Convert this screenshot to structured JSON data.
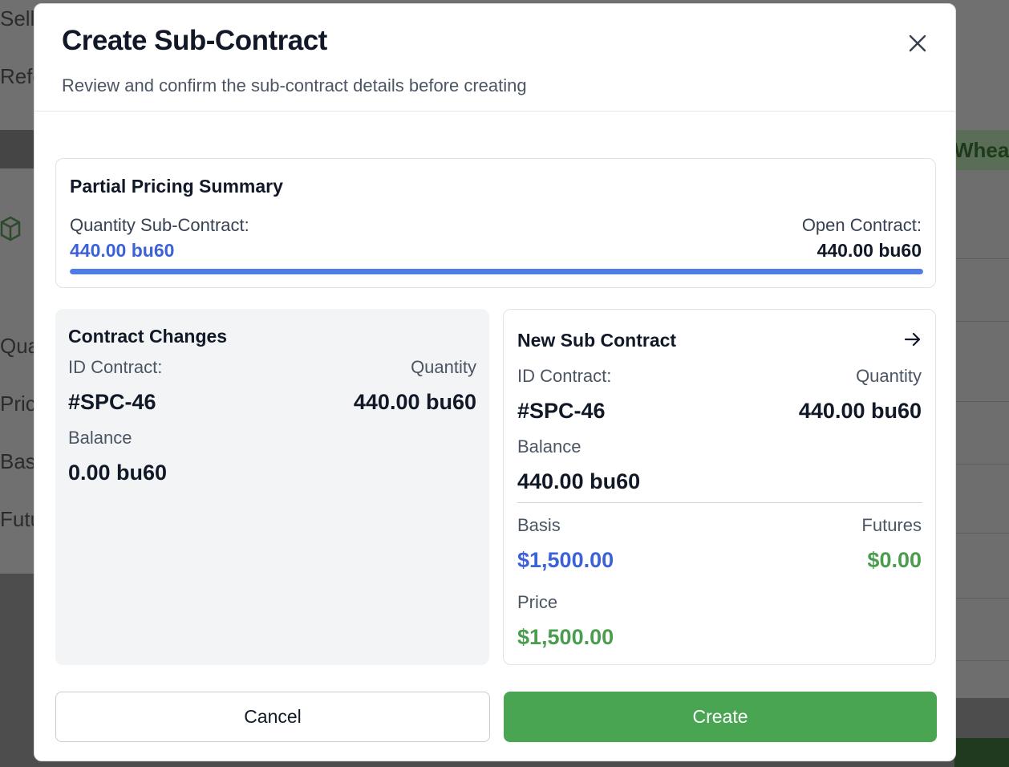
{
  "background": {
    "fragments": [
      "Selle",
      "Refe",
      "Qua",
      "Pric",
      "Basi",
      "Futu"
    ],
    "right_fragment": "Whea"
  },
  "modal": {
    "title": "Create Sub-Contract",
    "subtitle": "Review and confirm the sub-contract details before creating",
    "close_icon": "close-icon"
  },
  "summary": {
    "title": "Partial Pricing Summary",
    "left_label": "Quantity Sub-Contract:",
    "left_value": "440.00 bu60",
    "right_label": "Open Contract:",
    "right_value": "440.00 bu60",
    "progress_fraction": 1.0
  },
  "contract_changes": {
    "title": "Contract Changes",
    "id_label": "ID Contract:",
    "id_value": "#SPC-46",
    "quantity_label": "Quantity",
    "quantity_value": "440.00 bu60",
    "balance_label": "Balance",
    "balance_value": "0.00 bu60"
  },
  "new_sub_contract": {
    "title": "New Sub Contract",
    "arrow_icon": "arrow-right-icon",
    "id_label": "ID Contract:",
    "id_value": "#SPC-46",
    "quantity_label": "Quantity",
    "quantity_value": "440.00 bu60",
    "balance_label": "Balance",
    "balance_value": "440.00 bu60",
    "basis_label": "Basis",
    "basis_value": "$1,500.00",
    "futures_label": "Futures",
    "futures_value": "$0.00",
    "price_label": "Price",
    "price_value": "$1,500.00"
  },
  "buttons": {
    "cancel_label": "Cancel",
    "create_label": "Create"
  },
  "colors": {
    "accent_blue": "#3b62d6",
    "accent_green": "#4a9d4f",
    "create_button": "#4aa553",
    "progress": "#4f7ce6"
  }
}
